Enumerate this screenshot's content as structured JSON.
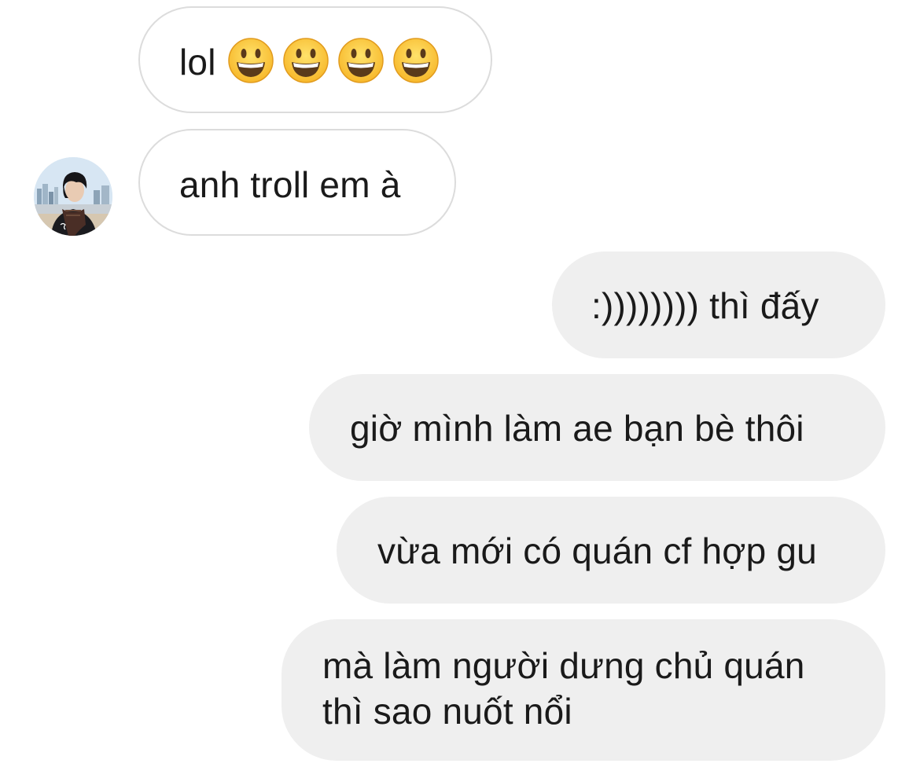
{
  "conversation": {
    "messages": [
      {
        "from": "contact",
        "text": "lol",
        "emoji_count": 4,
        "emoji_icon": "grinning-face-icon"
      },
      {
        "from": "contact",
        "text": "anh troll em à",
        "has_avatar": true
      },
      {
        "from": "me",
        "text": ":)))))))) thì đấy"
      },
      {
        "from": "me",
        "text": "giờ mình làm ae bạn bè thôi"
      },
      {
        "from": "me",
        "text": "vừa mới có quán cf hợp gu"
      },
      {
        "from": "me",
        "lines": [
          "mà làm người dưng chủ quán",
          "thì sao nuốt nổi"
        ]
      }
    ]
  },
  "colors": {
    "incoming_bubble_bg": "#ffffff",
    "incoming_bubble_border": "#dcdcdc",
    "outgoing_bubble_bg": "#efefef",
    "text": "#1a1a1a",
    "emoji_face": "#fdd13a",
    "emoji_outline": "#e19b1e"
  }
}
